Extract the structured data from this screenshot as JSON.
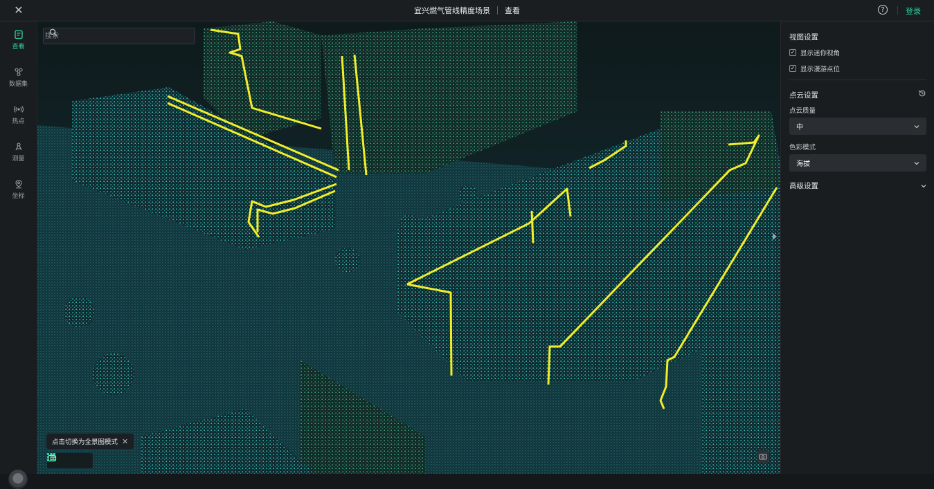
{
  "header": {
    "title": "宜兴燃气管线精度场景",
    "mode": "查看",
    "login_label": "登录"
  },
  "nav": [
    {
      "label": "查看",
      "icon": "edit-doc-icon",
      "active": true
    },
    {
      "label": "数据集",
      "icon": "dataset-icon",
      "active": false
    },
    {
      "label": "热点",
      "icon": "broadcast-icon",
      "active": false
    },
    {
      "label": "测量",
      "icon": "measure-icon",
      "active": false
    },
    {
      "label": "坐标",
      "icon": "location-pin-icon",
      "active": false
    }
  ],
  "search": {
    "placeholder": "搜索",
    "value": ""
  },
  "tooltip": {
    "text": "点击切换为全景图模式"
  },
  "panel": {
    "view_settings": {
      "title": "视图设置",
      "options": [
        {
          "label": "显示迷你视角",
          "checked": true
        },
        {
          "label": "显示漫游点位",
          "checked": true
        }
      ]
    },
    "pointcloud_settings": {
      "title": "点云设置",
      "quality_label": "点云质量",
      "quality_value": "中",
      "color_label": "色彩模式",
      "color_value": "海拔"
    },
    "advanced": {
      "title": "高级设置"
    }
  },
  "colors": {
    "accent": "#2fd39a",
    "pipeline": "#f2ee2a",
    "pointcloud": "#3fe0d8"
  }
}
